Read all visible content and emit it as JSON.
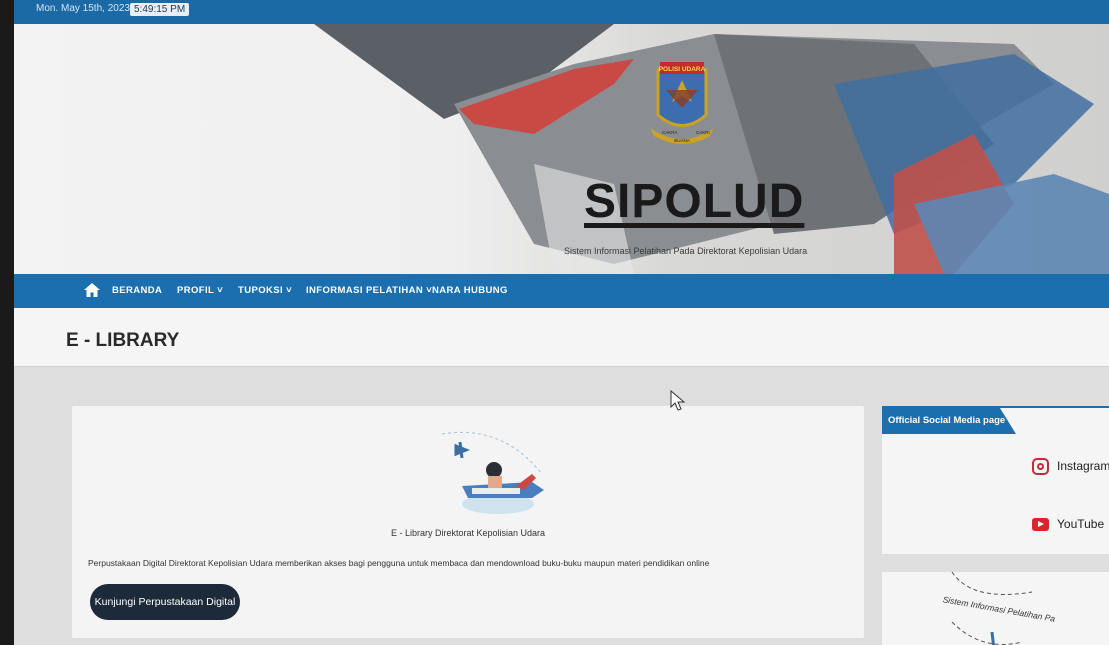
{
  "topbar": {
    "date": "Mon. May 15th, 2023",
    "time": "5:49:15 PM"
  },
  "header": {
    "emblem_text": "POLISI UDARA",
    "emblem_ribbon_left": "CAKRA",
    "emblem_ribbon_mid": "BUANA",
    "emblem_ribbon_right": "CAKRI",
    "site_title": "SIPOLUD",
    "tagline": "Sistem Informasi Pelatihan Pada Direktorat Kepolisian Udara"
  },
  "nav": {
    "home_icon": "home-icon",
    "items": [
      {
        "label": "BERANDA"
      },
      {
        "label": "PROFIL ˅"
      },
      {
        "label": "TUPOKSI ˅"
      },
      {
        "label": "INFORMASI PELATIHAN ˅"
      },
      {
        "label": "NARA HUBUNG"
      }
    ]
  },
  "page": {
    "title": "E - LIBRARY"
  },
  "main_card": {
    "caption": "E - Library Direktorat Kepolisian Udara",
    "description": "Perpustakaan Digital Direktorat Kepolisian Udara memberikan akses bagi pengguna untuk membaca dan mendownload buku-buku maupun materi pendidikan online",
    "button_label": "Kunjungi Perpustakaan Digital"
  },
  "sidebar": {
    "title": "Official Social Media page",
    "links": [
      {
        "label": "Instagram",
        "icon": "instagram-icon"
      },
      {
        "label": "YouTube",
        "icon": "youtube-icon"
      }
    ],
    "widget2_text": "Sistem Informasi Pelatihan Pa"
  },
  "colors": {
    "nav_blue": "#1c6fae",
    "topbar_blue": "#1b6aa5",
    "button_dark": "#1d2a3a"
  }
}
